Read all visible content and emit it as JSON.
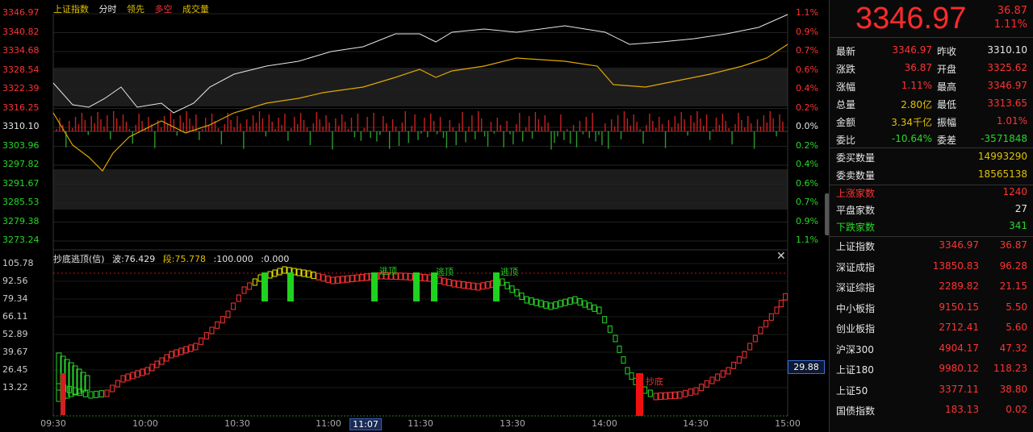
{
  "header": {
    "index_name": "上证指数",
    "mode": "分时",
    "lead": "领先",
    "longshort": "多空",
    "volume": "成交量"
  },
  "colors": {
    "up": "#ff3333",
    "down": "#26d926",
    "white_line": "#e8e8e8",
    "yellow_line": "#e0a800",
    "yellow": "#e0c000"
  },
  "price_axis": {
    "left_labels": [
      "3346.97",
      "3340.82",
      "3334.68",
      "3328.54",
      "3322.39",
      "3316.25",
      "3310.10",
      "3303.96",
      "3297.82",
      "3291.67",
      "3285.53",
      "3279.38",
      "3273.24"
    ],
    "right_labels": [
      "1.1%",
      "0.9%",
      "0.7%",
      "0.6%",
      "0.4%",
      "0.2%",
      "0.0%",
      "0.2%",
      "0.4%",
      "0.6%",
      "0.7%",
      "0.9%",
      "1.1%"
    ]
  },
  "time_axis": [
    "09:30",
    "10:00",
    "10:30",
    "11:00",
    "11:07",
    "11:30",
    "13:30",
    "14:00",
    "14:30",
    "15:00"
  ],
  "indicator": {
    "title": "抄底逃顶(信)",
    "wave_label": "波:76.429",
    "segment_label": "段:75.778",
    "v3": ":100.000",
    "v4": ":0.000",
    "axis_labels": [
      "105.78",
      "92.56",
      "79.34",
      "66.11",
      "52.89",
      "39.67",
      "26.45",
      "13.22"
    ],
    "current_value": "29.88",
    "signal_top": "逃顶",
    "signal_bottom": "抄底"
  },
  "quote": {
    "price": "3346.97",
    "change": "36.87",
    "change_pct": "1.11%",
    "rows": [
      {
        "l1": "最新",
        "v1": "3346.97",
        "c1": "r",
        "l2": "昨收",
        "v2": "3310.10",
        "c2": "w"
      },
      {
        "l1": "涨跌",
        "v1": "36.87",
        "c1": "r",
        "l2": "开盘",
        "v2": "3325.62",
        "c2": "r"
      },
      {
        "l1": "涨幅",
        "v1": "1.11%",
        "c1": "r",
        "l2": "最高",
        "v2": "3346.97",
        "c2": "r"
      },
      {
        "l1": "总量",
        "v1": "2.80亿",
        "c1": "y",
        "l2": "最低",
        "v2": "3313.65",
        "c2": "r"
      },
      {
        "l1": "金额",
        "v1": "3.34千亿",
        "c1": "y",
        "l2": "振幅",
        "v2": "1.01%",
        "c2": "r"
      },
      {
        "l1": "委比",
        "v1": "-10.64%",
        "c1": "g",
        "l2": "委差",
        "v2": "-3571848",
        "c2": "g"
      }
    ],
    "order_rows": [
      {
        "label": "委买数量",
        "value": "14993290"
      },
      {
        "label": "委卖数量",
        "value": "18565138"
      }
    ],
    "breadth_rows": [
      {
        "label": "上涨家数",
        "value": "1240",
        "color": "r"
      },
      {
        "label": "平盘家数",
        "value": "27",
        "color": "w"
      },
      {
        "label": "下跌家数",
        "value": "341",
        "color": "g"
      }
    ],
    "indices": [
      {
        "name": "上证指数",
        "value": "3346.97",
        "chg": "36.87"
      },
      {
        "name": "深证成指",
        "value": "13850.83",
        "chg": "96.28"
      },
      {
        "name": "深证综指",
        "value": "2289.82",
        "chg": "21.15"
      },
      {
        "name": "中小板指",
        "value": "9150.15",
        "chg": "5.50"
      },
      {
        "name": "创业板指",
        "value": "2712.41",
        "chg": "5.60"
      },
      {
        "name": "沪深300",
        "value": "4904.17",
        "chg": "47.32"
      },
      {
        "name": "上证180",
        "value": "9980.12",
        "chg": "118.23"
      },
      {
        "name": "上证50",
        "value": "3377.11",
        "chg": "38.80"
      },
      {
        "name": "国债指数",
        "value": "183.13",
        "chg": "0.02"
      }
    ]
  }
}
